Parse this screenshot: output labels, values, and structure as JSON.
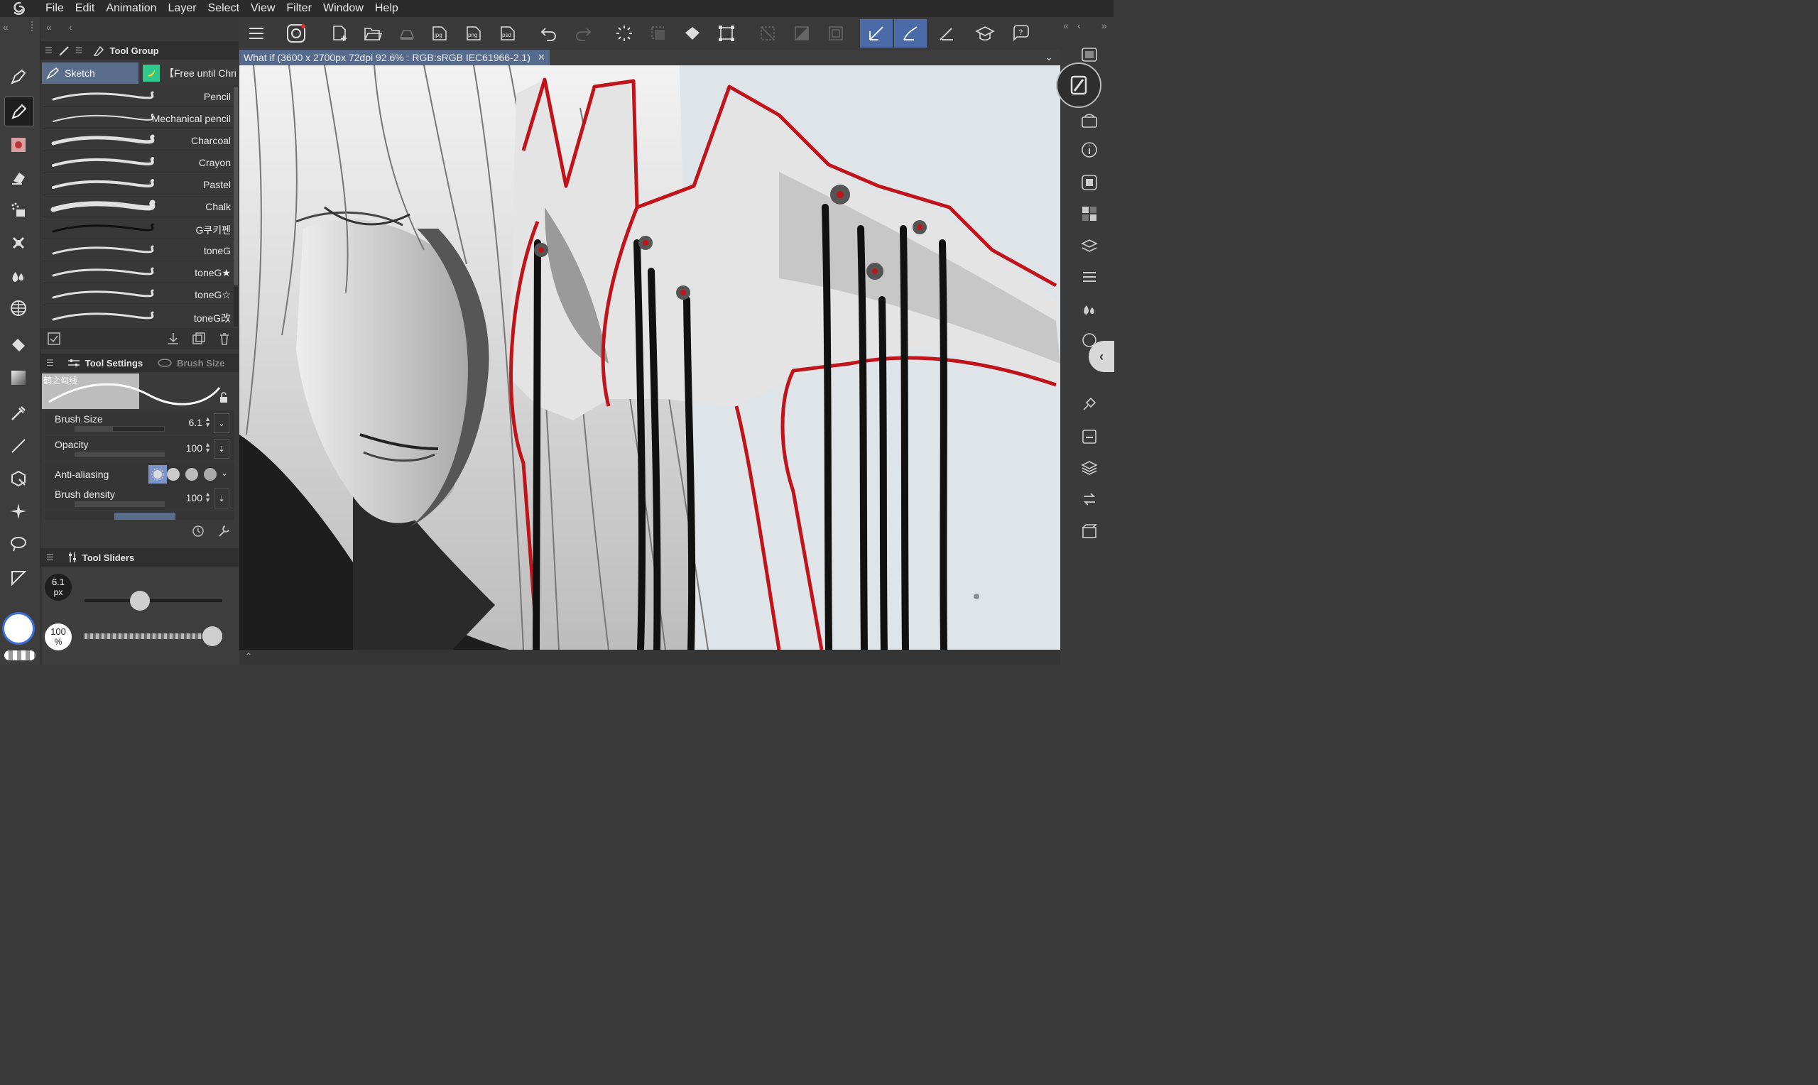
{
  "menu": [
    "File",
    "Edit",
    "Animation",
    "Layer",
    "Select",
    "View",
    "Filter",
    "Window",
    "Help"
  ],
  "tool_group": {
    "title": "Tool Group",
    "sub_tool_tab": "Sketch",
    "free_tab": "【Free until Chri",
    "brushes": [
      "Pencil",
      "Mechanical pencil",
      "Charcoal",
      "Crayon",
      "Pastel",
      "Chalk",
      "G쿠키펜",
      "toneG",
      "toneG★",
      "toneG☆",
      "toneG改"
    ]
  },
  "tool_settings": {
    "title": "Tool Settings",
    "brush_size_tab": "Brush Size",
    "preset_name": "鹤之勾线",
    "rows": [
      {
        "label": "Brush Size",
        "value": "6.1",
        "fill": 0.42
      },
      {
        "label": "Opacity",
        "value": "100",
        "fill": 1.0
      },
      {
        "label": "Anti-aliasing",
        "value": ""
      },
      {
        "label": "Brush density",
        "value": "100",
        "fill": 1.0
      }
    ]
  },
  "tool_sliders": {
    "title": "Tool Sliders",
    "size_badge_value": "6.1",
    "size_badge_unit": "px",
    "opacity_badge_value": "100",
    "opacity_badge_unit": "%",
    "size_level": 0.4,
    "opacity_level": 1.0
  },
  "document": {
    "tab_title": "What if (3600 x 2700px 72dpi 92.6% : RGB:sRGB IEC61966-2.1)"
  },
  "toolbar_icons": [
    "menu-icon",
    "clip-studio-icon",
    "new-canvas-icon",
    "open-folder-icon",
    "save-icon",
    "export-jpg-icon",
    "export-png-icon",
    "export-psd-icon",
    "undo-icon",
    "redo-icon",
    "loading-icon",
    "select-layer-icon",
    "fill-icon",
    "transform-icon",
    "deselect-icon",
    "invert-selection-icon",
    "crop-icon",
    "snap-ruler-icon",
    "snap-special-icon",
    "ruler-pen-icon",
    "learn-icon",
    "help-icon"
  ],
  "colors": {
    "accent": "#4a6aa8",
    "stroke_red": "#c0141a",
    "canvas_bg": "#d9dfe3"
  }
}
